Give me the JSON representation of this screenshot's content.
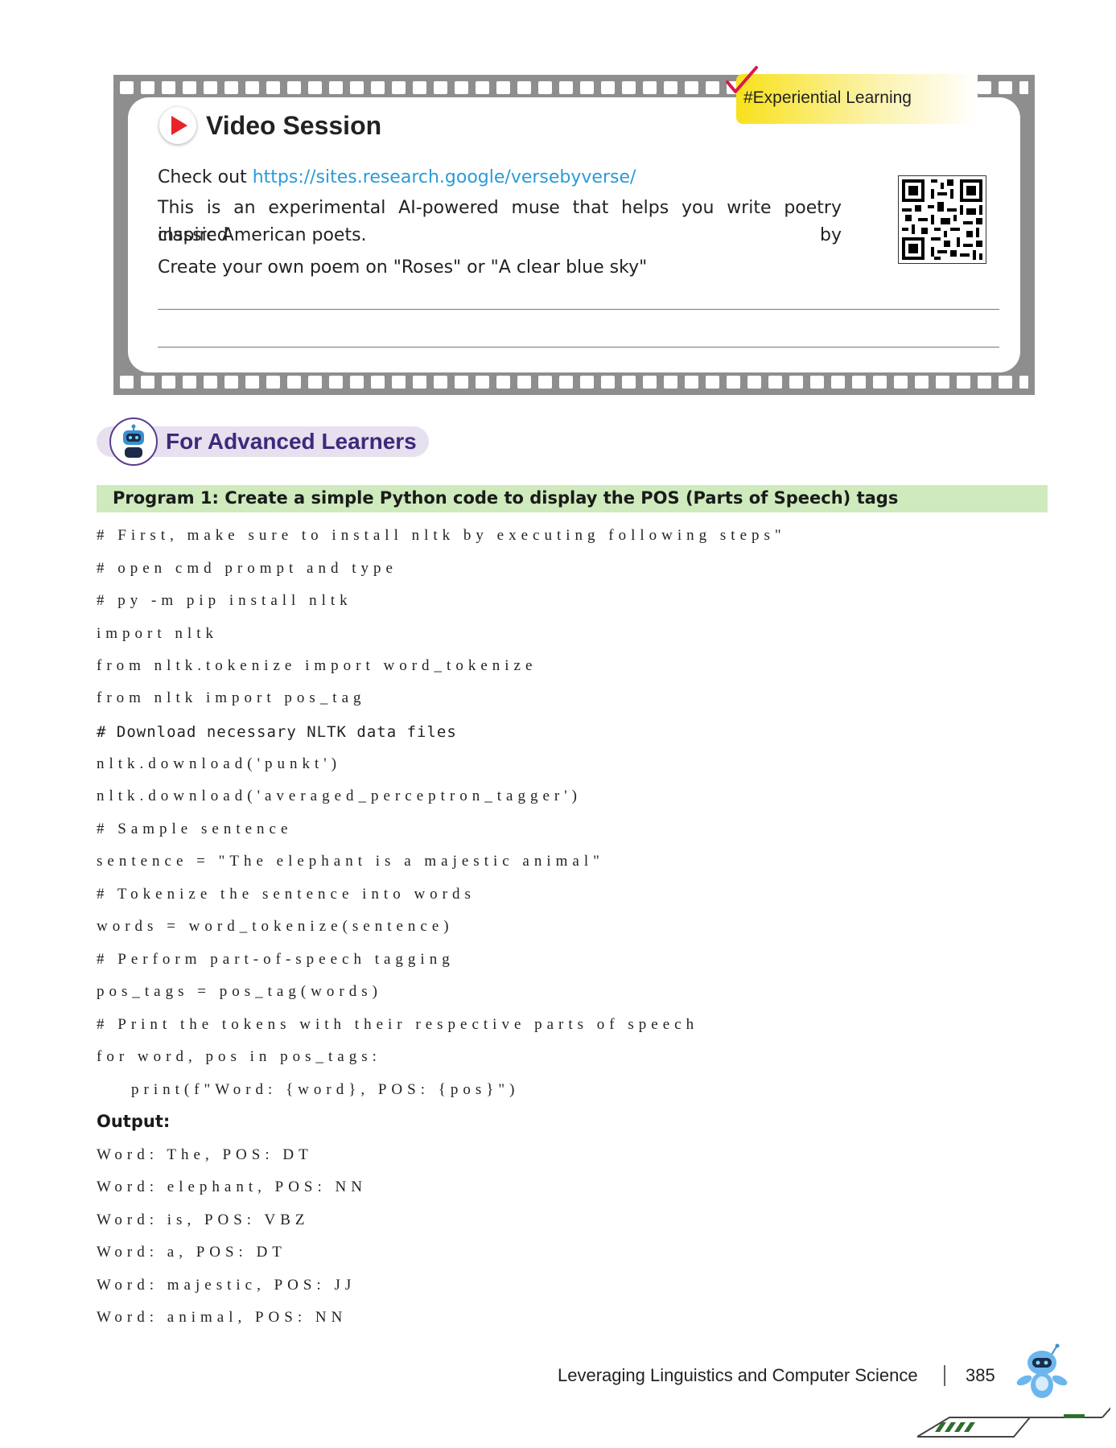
{
  "video_session": {
    "tag": "#Experiential Learning",
    "title": "Video Session",
    "check_out": "Check out",
    "link": "https://sites.research.google/versebyverse/",
    "description_1": "This is an experimental AI-powered muse that helps you write poetry inspired by",
    "description_2": "classic American poets.",
    "task": "Create your own poem on \"Roses\" or \"A clear blue sky\""
  },
  "advanced": {
    "heading": "For Advanced Learners",
    "program_title": "Program 1: Create a simple Python code to display the POS (Parts of Speech) tags",
    "code_lines": [
      "# First, make sure to install nltk by executing following steps\"",
      "# open cmd prompt and type",
      "# py -m pip install nltk",
      "import nltk",
      "from nltk.tokenize import word_tokenize",
      "from nltk import pos_tag",
      "# Download necessary NLTK data files",
      "nltk.download('punkt')",
      "nltk.download('averaged_perceptron_tagger')",
      "# Sample sentence",
      "sentence = \"The elephant is a majestic animal\"",
      "# Tokenize the sentence into words",
      "words = word_tokenize(sentence)",
      "# Perform part-of-speech tagging",
      "pos_tags = pos_tag(words)",
      "# Print the tokens with their respective parts of speech",
      "for word, pos in pos_tags:",
      "    print(f\"Word: {word}, POS: {pos}\")"
    ],
    "output_label": "Output:",
    "output_lines": [
      "Word: The, POS: DT",
      "Word: elephant, POS: NN",
      "Word: is, POS: VBZ",
      "Word: a, POS: DT",
      "Word: majestic, POS: JJ",
      "Word: animal, POS: NN"
    ]
  },
  "footer": {
    "chapter": "Leveraging Linguistics and Computer Science",
    "page_number": "385"
  },
  "colors": {
    "film_gray": "#8e8e8e",
    "link_blue": "#2a9bd8",
    "program_bar_green": "#cfeabc",
    "advanced_purple": "#3c2a7a",
    "play_red": "#e8232a"
  }
}
